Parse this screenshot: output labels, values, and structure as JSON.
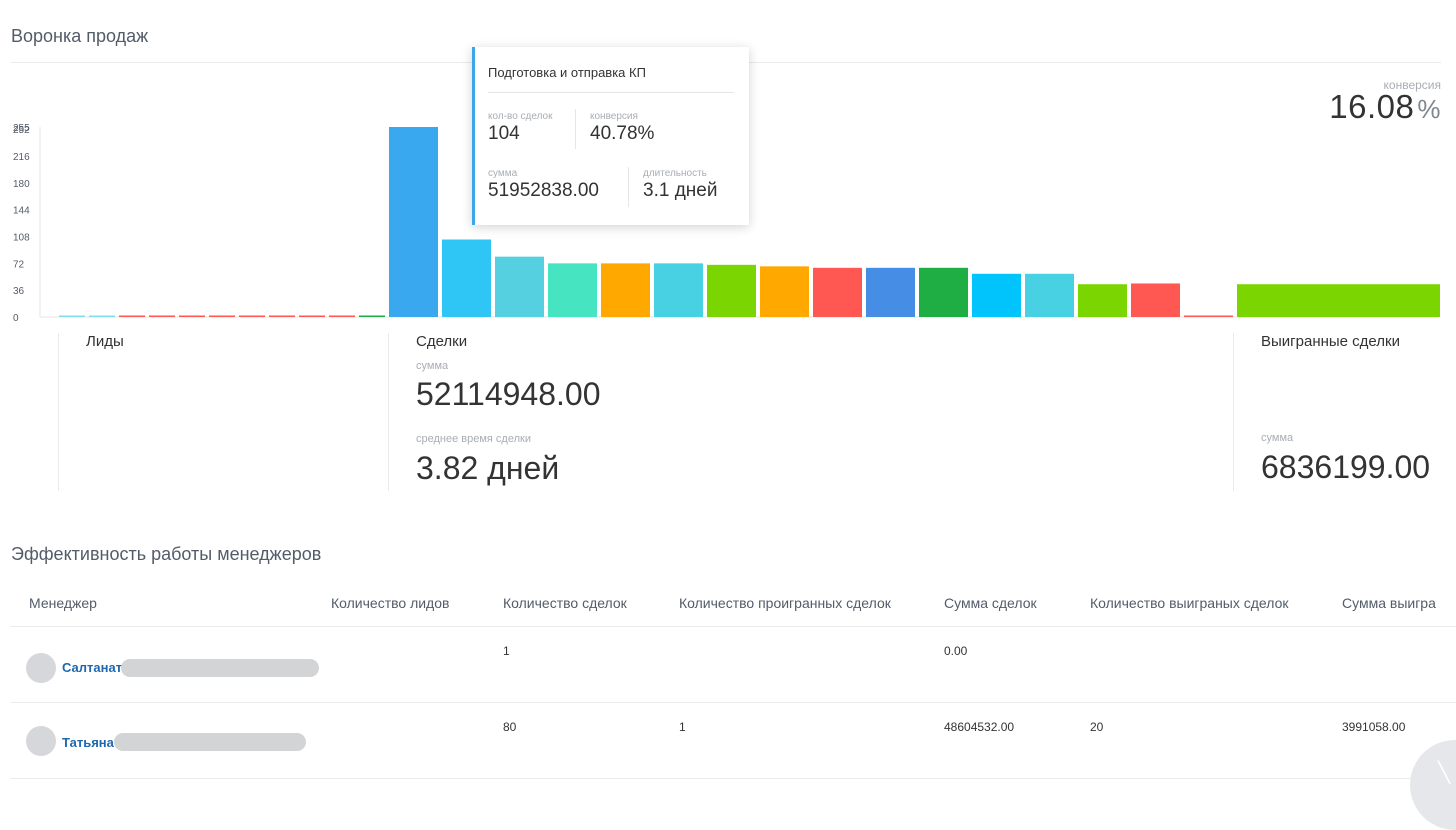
{
  "funnel": {
    "title": "Воронка продаж",
    "conversion_label": "конверсия",
    "conversion_value": "16.08",
    "conversion_unit": "%"
  },
  "chart_data": {
    "type": "bar",
    "y_ticks": [
      0,
      36,
      72,
      108,
      144,
      180,
      216,
      252,
      255
    ],
    "ylim": [
      0,
      255
    ],
    "bars": [
      {
        "value": 1,
        "color": "#80dfee"
      },
      {
        "value": 1,
        "color": "#80dfee"
      },
      {
        "value": 1,
        "color": "#ff5752"
      },
      {
        "value": 1,
        "color": "#ff5752"
      },
      {
        "value": 1,
        "color": "#ff5752"
      },
      {
        "value": 1,
        "color": "#ff5752"
      },
      {
        "value": 1,
        "color": "#ff5752"
      },
      {
        "value": 1,
        "color": "#ff5752"
      },
      {
        "value": 1,
        "color": "#ff5752"
      },
      {
        "value": 1,
        "color": "#ff5752"
      },
      {
        "value": 1,
        "color": "#1eae43"
      },
      {
        "value": 255,
        "color": "#39a8ef"
      },
      {
        "value": 104,
        "color": "#2fc6f6"
      },
      {
        "value": 81,
        "color": "#55d0e0"
      },
      {
        "value": 72,
        "color": "#47e4c2"
      },
      {
        "value": 72,
        "color": "#ffa900"
      },
      {
        "value": 72,
        "color": "#47d1e2"
      },
      {
        "value": 70,
        "color": "#7bd500"
      },
      {
        "value": 68,
        "color": "#ffa900"
      },
      {
        "value": 66,
        "color": "#ff5752"
      },
      {
        "value": 66,
        "color": "#468ee5"
      },
      {
        "value": 66,
        "color": "#1eae43"
      },
      {
        "value": 58,
        "color": "#00c4fb"
      },
      {
        "value": 58,
        "color": "#47d1e2"
      },
      {
        "value": 44,
        "color": "#7bd500"
      },
      {
        "value": 45,
        "color": "#ff5752"
      },
      {
        "value": 2,
        "color": "#ff5752"
      },
      {
        "value": 44,
        "color": "#7bd500"
      }
    ]
  },
  "tooltip": {
    "title": "Подготовка и отправка КП",
    "deals_count_label": "кол-во сделок",
    "deals_count": "104",
    "conversion_label": "конверсия",
    "conversion": "40.78%",
    "sum_label": "сумма",
    "sum": "51952838.00",
    "duration_label": "длительность",
    "duration": "3.1 дней"
  },
  "stats": {
    "leads": {
      "title": "Лиды"
    },
    "deals": {
      "title": "Сделки",
      "sum_label": "сумма",
      "sum": "52114948.00",
      "avg_time_label": "среднее время сделки",
      "avg_time": "3.82 дней"
    },
    "won": {
      "title": "Выигранные сделки",
      "sum_label": "сумма",
      "sum": "6836199.00"
    }
  },
  "managers": {
    "title": "Эффективность работы менеджеров",
    "columns": [
      "Менеджер",
      "Количество лидов",
      "Количество сделок",
      "Количество проигранных сделок",
      "Сумма сделок",
      "Количество выиграных сделок",
      "Сумма выигра"
    ],
    "rows": [
      {
        "name": "Салтанат",
        "leads": "",
        "deals": "1",
        "lost": "",
        "sum": "0.00",
        "won": "",
        "won_sum": ""
      },
      {
        "name": "Татьяна",
        "leads": "",
        "deals": "80",
        "lost": "1",
        "sum": "48604532.00",
        "won": "20",
        "won_sum": "3991058.00"
      }
    ]
  }
}
